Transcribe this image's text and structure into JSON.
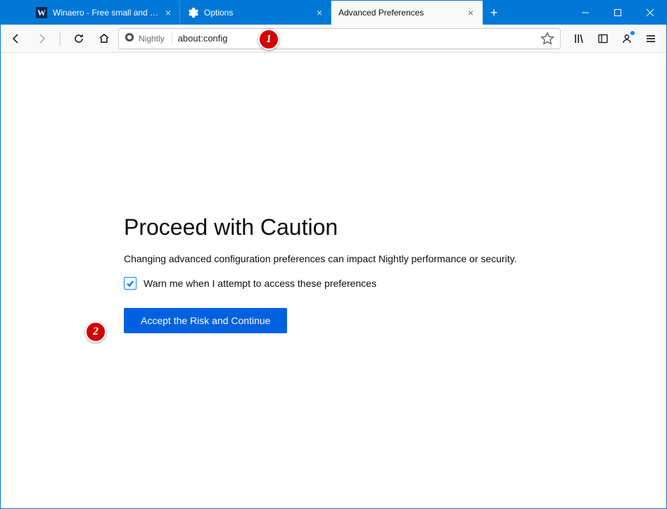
{
  "tabs": [
    {
      "title": "Winaero - Free small and usef…"
    },
    {
      "title": "Options"
    },
    {
      "title": "Advanced Preferences"
    }
  ],
  "urlbar": {
    "identity_label": "Nightly",
    "url": "about:config"
  },
  "page": {
    "heading": "Proceed with Caution",
    "warning_text": "Changing advanced configuration preferences can impact Nightly performance or security.",
    "checkbox_label": "Warn me when I attempt to access these preferences",
    "accept_button_label": "Accept the Risk and Continue"
  },
  "annotations": {
    "badge1": "1",
    "badge2": "2"
  }
}
